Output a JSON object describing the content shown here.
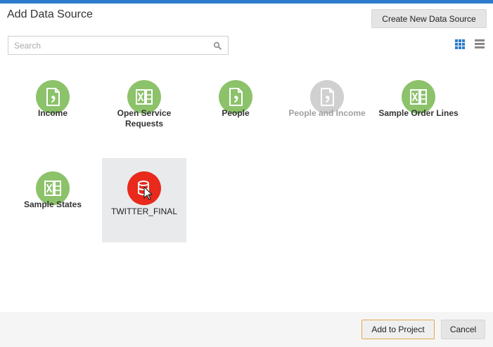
{
  "dialog": {
    "title": "Add Data Source",
    "create_button": "Create New Data Source"
  },
  "search": {
    "placeholder": "Search",
    "value": ""
  },
  "view_toggle": {
    "active": "grid",
    "grid_icon": "grid-view-icon",
    "list_icon": "list-view-icon"
  },
  "colors": {
    "accent": "#2d7ccc",
    "green": "#8cc26a",
    "gray": "#d0d0d0",
    "red": "#e8291c",
    "selected_bg": "#e9eaec"
  },
  "sources": [
    {
      "label": "Income",
      "icon": "csv-file-icon",
      "status": "normal"
    },
    {
      "label": "Open Service Requests",
      "icon": "excel-file-icon",
      "status": "normal"
    },
    {
      "label": "People",
      "icon": "csv-file-icon",
      "status": "normal"
    },
    {
      "label": "People and Income",
      "icon": "csv-file-icon",
      "status": "disabled"
    },
    {
      "label": "Sample Order Lines",
      "icon": "excel-file-icon",
      "status": "normal"
    },
    {
      "label": "Sample States",
      "icon": "excel-file-icon",
      "status": "normal"
    },
    {
      "label": "TWITTER_FINAL",
      "icon": "database-icon",
      "status": "selected"
    }
  ],
  "footer": {
    "add_button": "Add to Project",
    "cancel_button": "Cancel"
  }
}
